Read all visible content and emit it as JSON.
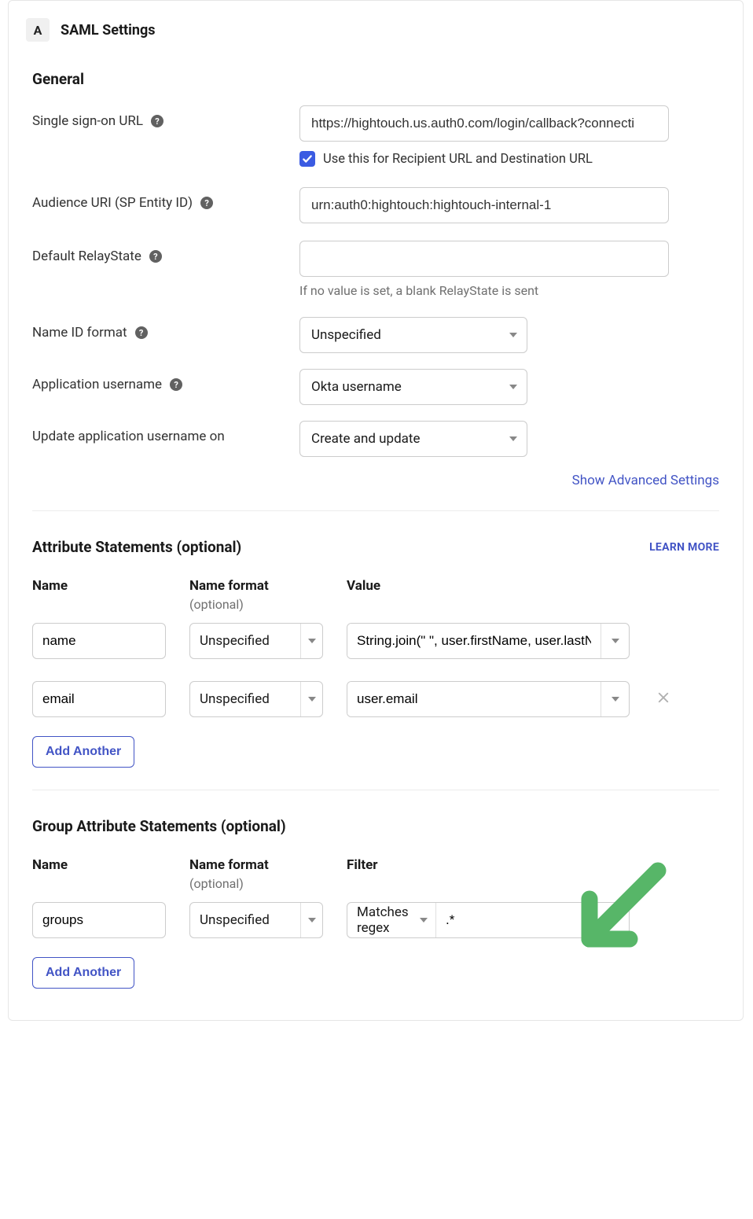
{
  "header": {
    "badge": "A",
    "title": "SAML Settings"
  },
  "general": {
    "heading": "General",
    "sso_label": "Single sign-on URL",
    "sso_value": "https://hightouch.us.auth0.com/login/callback?connecti",
    "sso_check_label": "Use this for Recipient URL and Destination URL",
    "audience_label": "Audience URI (SP Entity ID)",
    "audience_value": "urn:auth0:hightouch:hightouch-internal-1",
    "relay_label": "Default RelayState",
    "relay_value": "",
    "relay_hint": "If no value is set, a blank RelayState is sent",
    "nameid_label": "Name ID format",
    "nameid_value": "Unspecified",
    "appuser_label": "Application username",
    "appuser_value": "Okta username",
    "update_label": "Update application username on",
    "update_value": "Create and update",
    "advanced_label": "Show Advanced Settings"
  },
  "attr": {
    "heading": "Attribute Statements (optional)",
    "learn_more": "LEARN MORE",
    "th_name": "Name",
    "th_format": "Name format",
    "th_format_sub": "(optional)",
    "th_value": "Value",
    "rows": [
      {
        "name": "name",
        "format": "Unspecified",
        "value": "String.join(\" \", user.firstName, user.lastName)"
      },
      {
        "name": "email",
        "format": "Unspecified",
        "value": "user.email"
      }
    ],
    "add_label": "Add Another"
  },
  "group": {
    "heading": "Group Attribute Statements (optional)",
    "th_name": "Name",
    "th_format": "Name format",
    "th_format_sub": "(optional)",
    "th_filter": "Filter",
    "row": {
      "name": "groups",
      "format": "Unspecified",
      "filter_type": "Matches regex",
      "filter_value": ".*"
    },
    "add_label": "Add Another"
  }
}
